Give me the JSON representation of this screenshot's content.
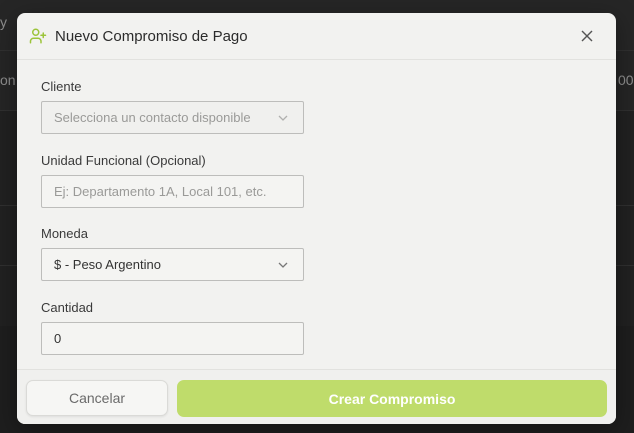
{
  "background": {
    "text_top_left": "y",
    "text_row_left": "on",
    "text_row_right": "00"
  },
  "modal": {
    "title": "Nuevo Compromiso de Pago",
    "icon": "user-plus-icon",
    "accent_color": "#bfdc6b"
  },
  "form": {
    "cliente": {
      "label": "Cliente",
      "placeholder": "Selecciona un contacto disponible"
    },
    "unidad": {
      "label": "Unidad Funcional (Opcional)",
      "placeholder": "Ej: Departamento 1A, Local 101, etc."
    },
    "moneda": {
      "label": "Moneda",
      "value": "$ - Peso Argentino"
    },
    "cantidad": {
      "label": "Cantidad",
      "value": "0"
    }
  },
  "footer": {
    "cancel_label": "Cancelar",
    "create_label": "Crear Compromiso"
  }
}
